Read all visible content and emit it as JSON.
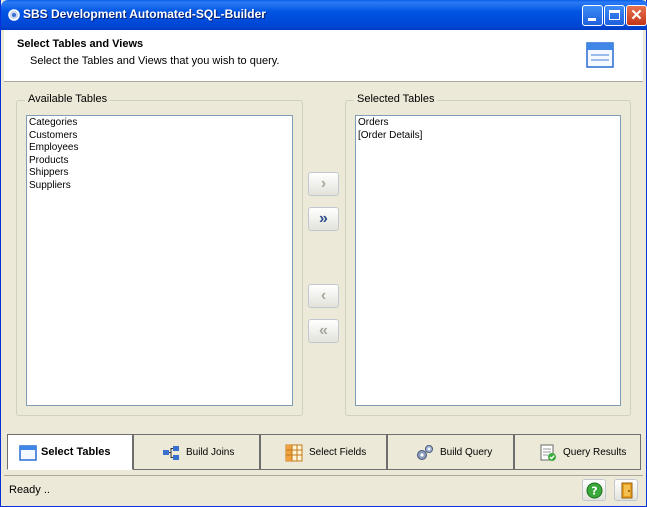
{
  "window": {
    "title": "SBS Development Automated-SQL-Builder"
  },
  "header": {
    "title": "Select Tables and Views",
    "subtitle": "Select the Tables and Views that you wish to query."
  },
  "available": {
    "label": "Available Tables",
    "items": [
      "Categories",
      "Customers",
      "Employees",
      "Products",
      "Shippers",
      "Suppliers"
    ]
  },
  "selected": {
    "label": "Selected Tables",
    "items": [
      "Orders",
      "[Order Details]"
    ]
  },
  "buttons": {
    "add_one": "›",
    "add_all": "»",
    "remove_one": "‹",
    "remove_all": "«"
  },
  "tabs": [
    {
      "label": "Select Tables",
      "icon": "window-icon",
      "active": true
    },
    {
      "label": "Build Joins",
      "icon": "joins-icon",
      "active": false
    },
    {
      "label": "Select Fields",
      "icon": "grid-icon",
      "active": false
    },
    {
      "label": "Build Query",
      "icon": "gears-icon",
      "active": false
    },
    {
      "label": "Query Results",
      "icon": "results-icon",
      "active": false
    }
  ],
  "status": {
    "text": "Ready .."
  },
  "colors": {
    "titlebar": "#0054E3",
    "face": "#ECE9D8",
    "accent": "#2F4F8F"
  }
}
